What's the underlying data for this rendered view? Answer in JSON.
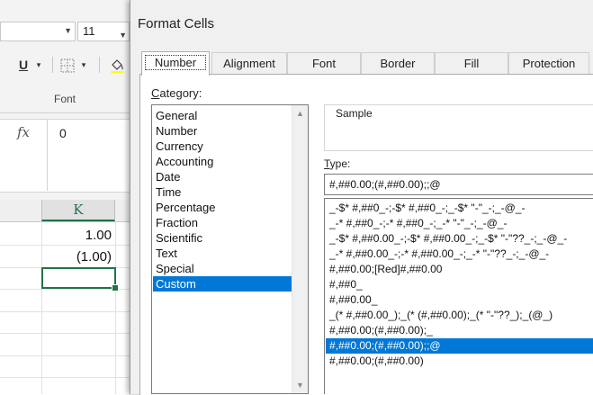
{
  "excel": {
    "font_size": "11",
    "underline_label": "U",
    "font_group_label": "Font",
    "fx_label": "fx",
    "formula_value": "0",
    "column_header": "K",
    "cells": [
      "1.00",
      "(1.00)"
    ]
  },
  "dialog": {
    "title": "Format Cells",
    "tabs": [
      "Number",
      "Alignment",
      "Font",
      "Border",
      "Fill",
      "Protection"
    ],
    "active_tab": "Number",
    "category_label_prefix": "C",
    "category_label_rest": "ategory:",
    "categories": [
      "General",
      "Number",
      "Currency",
      "Accounting",
      "Date",
      "Time",
      "Percentage",
      "Fraction",
      "Scientific",
      "Text",
      "Special",
      "Custom"
    ],
    "selected_category": "Custom",
    "sample_label": "Sample",
    "type_label_prefix": "T",
    "type_label_rest": "ype:",
    "type_value": "#,##0.00;(#,##0.00);;@",
    "formats": [
      "_-$* #,##0_-;-$* #,##0_-;_-$* \"-\"_-;_-@_-",
      "_-* #,##0_-;-* #,##0_-;_-* \"-\"_-;_-@_-",
      "_-$* #,##0.00_-;-$* #,##0.00_-;_-$* \"-\"??_-;_-@_-",
      "_-* #,##0.00_-;-* #,##0.00_-;_-* \"-\"??_-;_-@_-",
      "#,##0.00;[Red]#,##0.00",
      "#,##0_",
      "#,##0.00_",
      "_(* #,##0.00_);_(* (#,##0.00);_(* \"-\"??_);_(@_)",
      "#,##0.00;(#,##0.00);_",
      "#,##0.00;(#,##0.00);;@",
      "#,##0.00;(#,##0.00)"
    ],
    "selected_format_index": 9
  },
  "colors": {
    "selection": "#0078d7",
    "excel_green": "#217346"
  }
}
